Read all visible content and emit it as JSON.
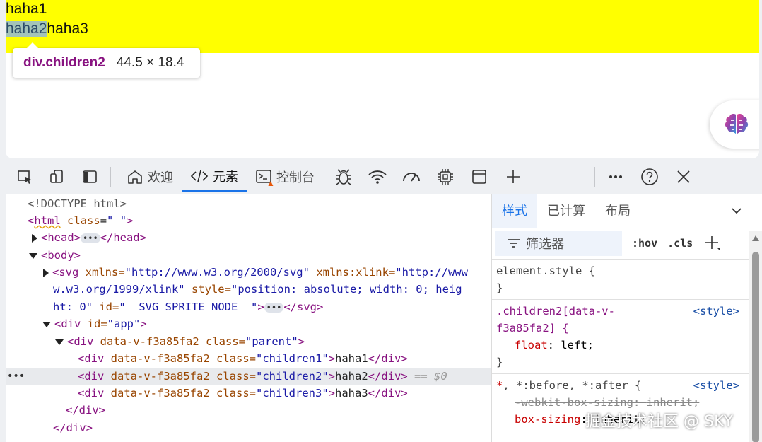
{
  "page": {
    "line1": "haha1",
    "line2_highlight": "haha2",
    "line2_rest": "haha3",
    "yellow_bg": "#ffff00",
    "tooltip": {
      "selector": "div.children2",
      "size": "44.5 × 18.4"
    }
  },
  "toolbar": {
    "tabs": [
      {
        "label": "欢迎",
        "icon": "home-icon"
      },
      {
        "label": "元素",
        "icon": "code-icon",
        "active": true
      },
      {
        "label": "控制台",
        "icon": "console-icon"
      }
    ],
    "icons": [
      "inspect-icon",
      "device-icon",
      "dock-icon",
      "bug-icon",
      "wifi-icon",
      "performance-icon",
      "memory-icon",
      "application-icon",
      "add-icon",
      "more-icon",
      "help-icon",
      "close-icon"
    ]
  },
  "dom": {
    "doctype": "<!DOCTYPE html>",
    "html_open_tag": "html",
    "html_class_attr": "class",
    "html_class_val": "\" \"",
    "head_tag": "<head>",
    "head_close": "</head>",
    "body_tag": "<body>",
    "svg_line1_a": "<svg",
    "svg_line1_b": "xmlns=",
    "svg_line1_c": "\"http://www.w3.org/2000/svg\"",
    "svg_line1_d": "xmlns:xlink=",
    "svg_line1_e": "\"http://www",
    "svg_line2_a": "w.w3.org/1999/xlink\"",
    "svg_line2_b": "style=",
    "svg_line2_c": "\"position: absolute; width: 0; heig",
    "svg_line3_a": "ht: 0\"",
    "svg_line3_b": "id=",
    "svg_line3_c": "\"__SVG_SPRITE_NODE__\"",
    "svg_line3_d": ">",
    "svg_close": "</svg>",
    "app_open": "<div",
    "app_attr": "id=",
    "app_val": "\"app\"",
    "parent_attr1": "data-v-f3a85fa2",
    "parent_attr2": "class=",
    "parent_val": "\"parent\"",
    "c1_val": "\"children1\"",
    "c1_text": "haha1",
    "c2_val": "\"children2\"",
    "c2_text": "haha2",
    "c3_val": "\"children3\"",
    "c3_text": "haha3",
    "div_close": "</div>",
    "dollar0": "== $0",
    "gt": ">"
  },
  "styles": {
    "tabs": [
      "样式",
      "已计算",
      "布局"
    ],
    "filter_placeholder": "筛选器",
    "hov": ":hov",
    "cls": ".cls",
    "element_style": "element.style {",
    "close_brace": "}",
    "rule2_selector_a": ".children2[data-v-",
    "rule2_selector_b": "f3a85fa2] {",
    "rule2_source": "<style>",
    "rule2_prop": "float",
    "rule2_value": "left;",
    "rule3_selector_a": "*",
    "rule3_selector_b": ", *:before, *:after {",
    "rule3_source": "<style>",
    "rule3_prop1": "-webkit-box-sizing",
    "rule3_value1": "inherit;",
    "rule3_prop2": "box-sizing",
    "rule3_value2": "inherit;"
  },
  "watermark": "掘金技术社区 @ SKY"
}
